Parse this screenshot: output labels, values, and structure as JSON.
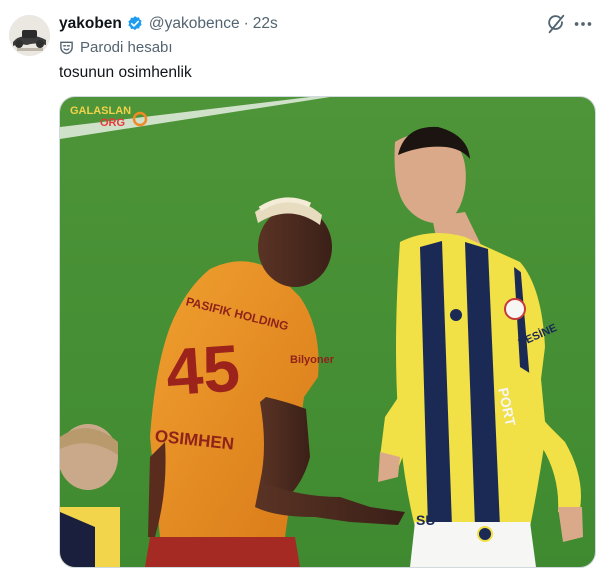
{
  "tweet": {
    "display_name": "yakoben",
    "handle": "@yakobence",
    "separator": "·",
    "time": "22s",
    "parody_label": "Parodi hesabı",
    "text": "tosunun osimhenlik",
    "icons": {
      "verified": "verified-badge-icon",
      "grok": "grok-icon",
      "more": "more-options-icon",
      "parody": "parody-mask-icon"
    },
    "colors": {
      "verified": "#1d9bf0",
      "secondary_text": "#536471"
    }
  },
  "media": {
    "watermark_line1": "GALASLAN",
    "watermark_line2": "ORG",
    "jersey_text": "PASIFIK HOLDING",
    "jersey_number": "45",
    "jersey_name": "OSIMHEN",
    "sleeve_sponsor": "Bilyoner",
    "opponent_chest": "PORT",
    "opponent_shorts": "SU",
    "opponent_sleeve": "HESİNE"
  }
}
